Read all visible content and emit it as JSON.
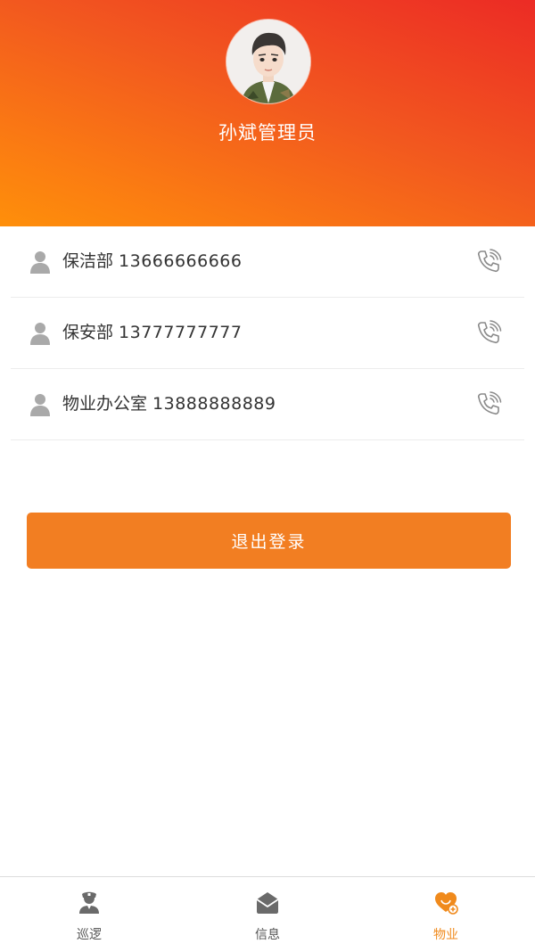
{
  "profile": {
    "name": "孙斌管理员"
  },
  "contacts": [
    {
      "department": "保洁部",
      "phone": "13666666666"
    },
    {
      "department": "保安部",
      "phone": "13777777777"
    },
    {
      "department": "物业办公室",
      "phone": "13888888889"
    }
  ],
  "actions": {
    "logout_label": "退出登录"
  },
  "tabs": [
    {
      "label": "巡逻",
      "icon": "patrol-officer-icon"
    },
    {
      "label": "信息",
      "icon": "envelope-icon"
    },
    {
      "label": "物业",
      "icon": "property-heart-icon",
      "active": true
    }
  ],
  "colors": {
    "header_gradient_start": "#fe8f0a",
    "header_gradient_end": "#ec2b25",
    "accent": "#f27e22",
    "active_tab": "#f08a1c"
  }
}
